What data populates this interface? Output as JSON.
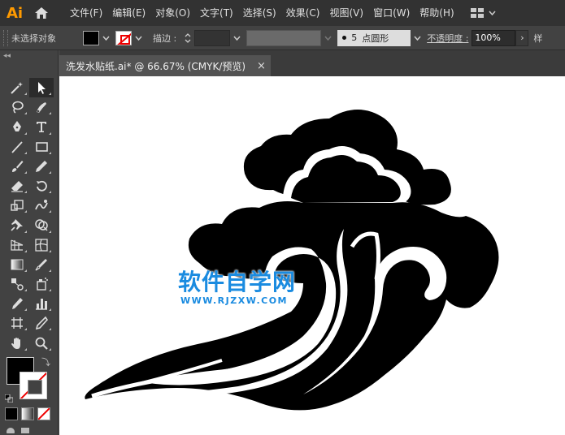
{
  "app": {
    "logo_text": "Ai",
    "accent_color": "#ff9a00"
  },
  "menubar": {
    "items": [
      {
        "label": "文件(F)"
      },
      {
        "label": "编辑(E)"
      },
      {
        "label": "对象(O)"
      },
      {
        "label": "文字(T)"
      },
      {
        "label": "选择(S)"
      },
      {
        "label": "效果(C)"
      },
      {
        "label": "视图(V)"
      },
      {
        "label": "窗口(W)"
      },
      {
        "label": "帮助(H)"
      }
    ],
    "workspace_icon": "grid-layout-icon"
  },
  "controlbar": {
    "selection_status": "未选择对象",
    "fill_color": "#000000",
    "stroke_color": "none",
    "stroke_label": "描边 :",
    "brush_size": "5",
    "brush_name": "点圆形",
    "opacity_label": "不透明度 :",
    "opacity_value": "100%",
    "more_label": "样"
  },
  "toolbar": {
    "collapse_label": "◂◂",
    "tools": [
      {
        "name": "magic-wand-icon"
      },
      {
        "name": "selection-arrow-icon"
      },
      {
        "name": "lasso-icon"
      },
      {
        "name": "direct-selection-icon"
      },
      {
        "name": "pen-icon"
      },
      {
        "name": "type-icon"
      },
      {
        "name": "line-icon"
      },
      {
        "name": "rectangle-icon"
      },
      {
        "name": "paintbrush-icon"
      },
      {
        "name": "pencil-icon"
      },
      {
        "name": "eraser-icon"
      },
      {
        "name": "rotate-icon"
      },
      {
        "name": "scale-icon"
      },
      {
        "name": "warp-icon"
      },
      {
        "name": "puppet-pin-icon"
      },
      {
        "name": "shape-builder-icon"
      },
      {
        "name": "perspective-grid-icon"
      },
      {
        "name": "mesh-icon"
      },
      {
        "name": "gradient-icon"
      },
      {
        "name": "eyedropper-icon"
      },
      {
        "name": "blend-icon"
      },
      {
        "name": "symbol-sprayer-icon"
      },
      {
        "name": "eyedropper-alt-icon"
      },
      {
        "name": "graph-icon"
      },
      {
        "name": "artboard-icon"
      },
      {
        "name": "slice-icon"
      },
      {
        "name": "hand-icon"
      },
      {
        "name": "zoom-icon"
      }
    ],
    "fill_color": "#000000",
    "stroke_color": "none"
  },
  "document": {
    "tab_title": "洗发水贴纸.ai* @ 66.67% (CMYK/预览)",
    "close_label": "×"
  },
  "watermark": {
    "title": "软件自学网",
    "url": "WWW.RJZXW.COM",
    "color": "#1a8be0"
  }
}
